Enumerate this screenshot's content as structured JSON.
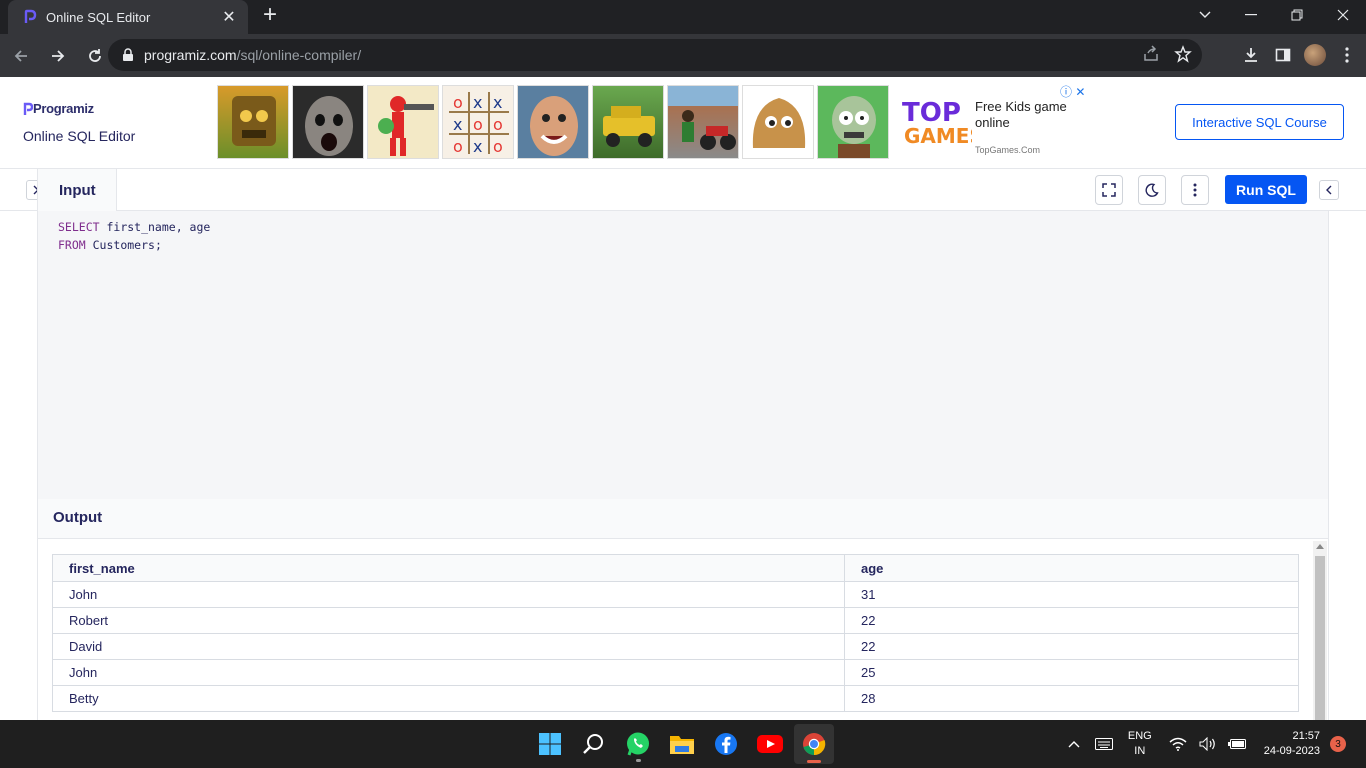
{
  "browser": {
    "tab_title": "Online SQL Editor",
    "url_domain": "programiz.com",
    "url_path": "/sql/online-compiler/"
  },
  "header": {
    "logo_text": "Programiz",
    "subtitle": "Online SQL Editor",
    "course_button": "Interactive SQL Course"
  },
  "ad": {
    "brand": "TOP GAMES",
    "text": "Free Kids game online",
    "source": "TopGames.Com",
    "thumbnails": [
      "temple-runner",
      "horror-face",
      "red-hero",
      "tic-tac-toe",
      "smiling-man",
      "yellow-jeep",
      "city-biker",
      "pou-blob",
      "zombie-head"
    ]
  },
  "editor": {
    "input_tab": "Input",
    "run_button": "Run SQL",
    "code_lines": [
      {
        "keyword": "SELECT",
        "rest": " first_name, age"
      },
      {
        "keyword": "FROM",
        "rest": " Customers;"
      }
    ]
  },
  "output": {
    "title": "Output",
    "columns": [
      "first_name",
      "age"
    ],
    "rows": [
      [
        "John",
        "31"
      ],
      [
        "Robert",
        "22"
      ],
      [
        "David",
        "22"
      ],
      [
        "John",
        "25"
      ],
      [
        "Betty",
        "28"
      ]
    ]
  },
  "taskbar": {
    "lang_line1": "ENG",
    "lang_line2": "IN",
    "time": "21:57",
    "date": "24-09-2023",
    "notification_count": "3"
  },
  "colors": {
    "accent": "#0556f3",
    "text_dark": "#25265e",
    "sql_keyword": "#7f2d8d"
  }
}
